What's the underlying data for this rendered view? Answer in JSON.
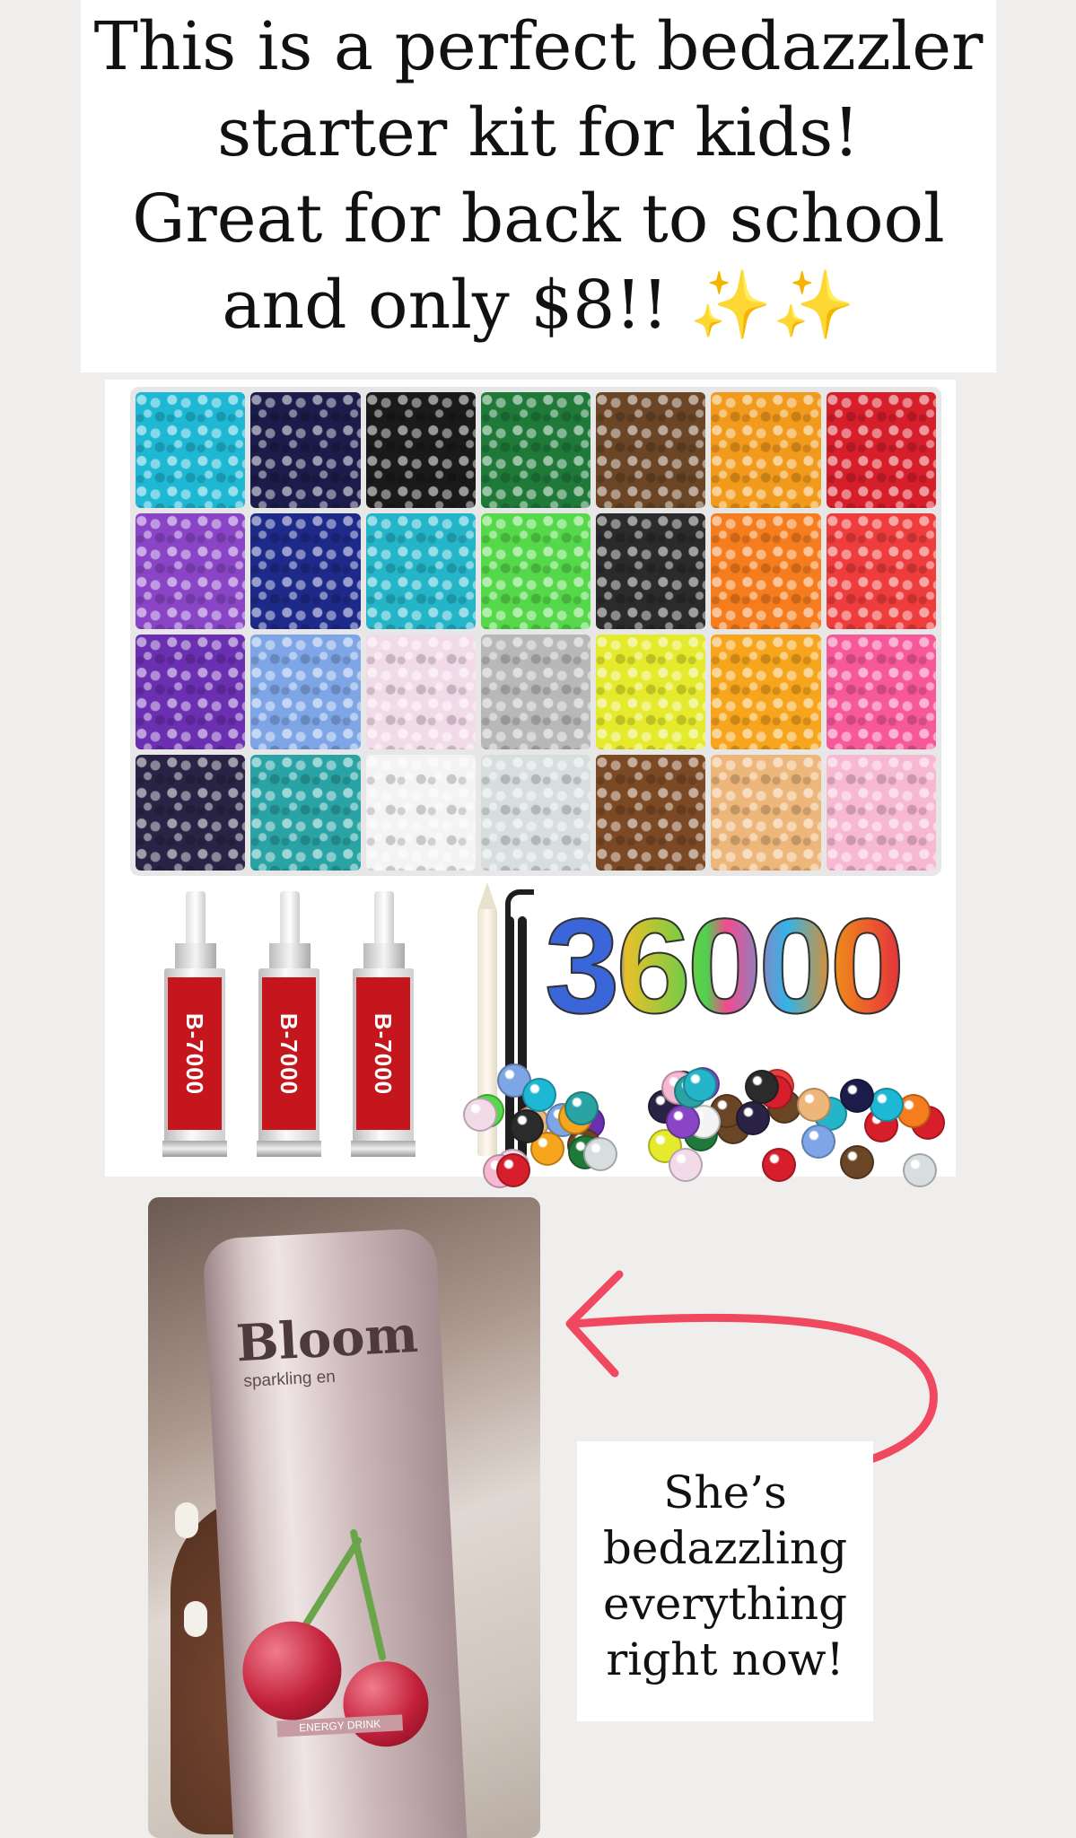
{
  "headline": {
    "lines": [
      "This is a perfect bedazzler",
      "starter kit for kids!",
      "Great for back to school",
      "and only $8!! ✨✨"
    ]
  },
  "product": {
    "tray_colors": [
      "#1fb8d4",
      "#1b1c4a",
      "#1a1a1a",
      "#1f7a3a",
      "#6a4526",
      "#f19a1c",
      "#d71f2b",
      "#8a45c7",
      "#1d2a8a",
      "#24b5c9",
      "#55d84a",
      "#2b2b2b",
      "#f57d1e",
      "#ef3c3c",
      "#6b2fb2",
      "#7ea6e6",
      "#f2dbe8",
      "#b8b8b8",
      "#e5ea2c",
      "#f7a51d",
      "#f7589a",
      "#2a2345",
      "#2aa3a5",
      "#f4f4f4",
      "#d8dedf",
      "#7b4a25",
      "#edb67a",
      "#f7b8d2"
    ],
    "glue_label": "B-7000",
    "big_number": "36000"
  },
  "photo": {
    "brand": "Bloom",
    "subtitle": "sparkling en",
    "strip_text": "ENERGY DRINK"
  },
  "arrow_color": "#f0485e",
  "caption": {
    "lines": [
      "She’s",
      "bedazzling",
      "everything",
      "right now!"
    ]
  }
}
